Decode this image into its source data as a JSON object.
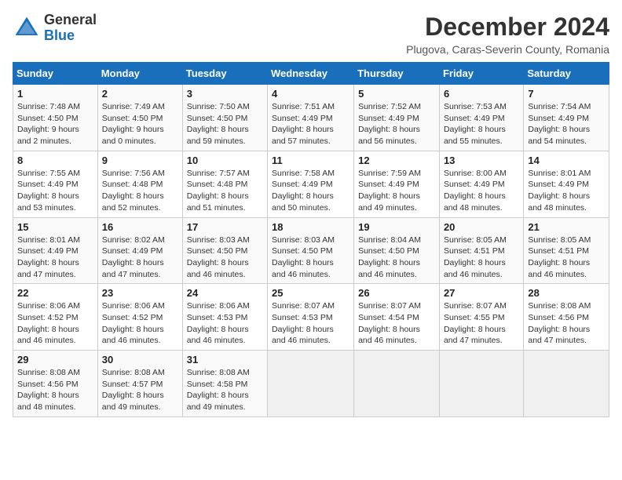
{
  "header": {
    "logo_general": "General",
    "logo_blue": "Blue",
    "month_title": "December 2024",
    "location": "Plugova, Caras-Severin County, Romania"
  },
  "weekdays": [
    "Sunday",
    "Monday",
    "Tuesday",
    "Wednesday",
    "Thursday",
    "Friday",
    "Saturday"
  ],
  "weeks": [
    [
      {
        "day": "1",
        "info": "Sunrise: 7:48 AM\nSunset: 4:50 PM\nDaylight: 9 hours\nand 2 minutes."
      },
      {
        "day": "2",
        "info": "Sunrise: 7:49 AM\nSunset: 4:50 PM\nDaylight: 9 hours\nand 0 minutes."
      },
      {
        "day": "3",
        "info": "Sunrise: 7:50 AM\nSunset: 4:50 PM\nDaylight: 8 hours\nand 59 minutes."
      },
      {
        "day": "4",
        "info": "Sunrise: 7:51 AM\nSunset: 4:49 PM\nDaylight: 8 hours\nand 57 minutes."
      },
      {
        "day": "5",
        "info": "Sunrise: 7:52 AM\nSunset: 4:49 PM\nDaylight: 8 hours\nand 56 minutes."
      },
      {
        "day": "6",
        "info": "Sunrise: 7:53 AM\nSunset: 4:49 PM\nDaylight: 8 hours\nand 55 minutes."
      },
      {
        "day": "7",
        "info": "Sunrise: 7:54 AM\nSunset: 4:49 PM\nDaylight: 8 hours\nand 54 minutes."
      }
    ],
    [
      {
        "day": "8",
        "info": "Sunrise: 7:55 AM\nSunset: 4:49 PM\nDaylight: 8 hours\nand 53 minutes."
      },
      {
        "day": "9",
        "info": "Sunrise: 7:56 AM\nSunset: 4:48 PM\nDaylight: 8 hours\nand 52 minutes."
      },
      {
        "day": "10",
        "info": "Sunrise: 7:57 AM\nSunset: 4:48 PM\nDaylight: 8 hours\nand 51 minutes."
      },
      {
        "day": "11",
        "info": "Sunrise: 7:58 AM\nSunset: 4:49 PM\nDaylight: 8 hours\nand 50 minutes."
      },
      {
        "day": "12",
        "info": "Sunrise: 7:59 AM\nSunset: 4:49 PM\nDaylight: 8 hours\nand 49 minutes."
      },
      {
        "day": "13",
        "info": "Sunrise: 8:00 AM\nSunset: 4:49 PM\nDaylight: 8 hours\nand 48 minutes."
      },
      {
        "day": "14",
        "info": "Sunrise: 8:01 AM\nSunset: 4:49 PM\nDaylight: 8 hours\nand 48 minutes."
      }
    ],
    [
      {
        "day": "15",
        "info": "Sunrise: 8:01 AM\nSunset: 4:49 PM\nDaylight: 8 hours\nand 47 minutes."
      },
      {
        "day": "16",
        "info": "Sunrise: 8:02 AM\nSunset: 4:49 PM\nDaylight: 8 hours\nand 47 minutes."
      },
      {
        "day": "17",
        "info": "Sunrise: 8:03 AM\nSunset: 4:50 PM\nDaylight: 8 hours\nand 46 minutes."
      },
      {
        "day": "18",
        "info": "Sunrise: 8:03 AM\nSunset: 4:50 PM\nDaylight: 8 hours\nand 46 minutes."
      },
      {
        "day": "19",
        "info": "Sunrise: 8:04 AM\nSunset: 4:50 PM\nDaylight: 8 hours\nand 46 minutes."
      },
      {
        "day": "20",
        "info": "Sunrise: 8:05 AM\nSunset: 4:51 PM\nDaylight: 8 hours\nand 46 minutes."
      },
      {
        "day": "21",
        "info": "Sunrise: 8:05 AM\nSunset: 4:51 PM\nDaylight: 8 hours\nand 46 minutes."
      }
    ],
    [
      {
        "day": "22",
        "info": "Sunrise: 8:06 AM\nSunset: 4:52 PM\nDaylight: 8 hours\nand 46 minutes."
      },
      {
        "day": "23",
        "info": "Sunrise: 8:06 AM\nSunset: 4:52 PM\nDaylight: 8 hours\nand 46 minutes."
      },
      {
        "day": "24",
        "info": "Sunrise: 8:06 AM\nSunset: 4:53 PM\nDaylight: 8 hours\nand 46 minutes."
      },
      {
        "day": "25",
        "info": "Sunrise: 8:07 AM\nSunset: 4:53 PM\nDaylight: 8 hours\nand 46 minutes."
      },
      {
        "day": "26",
        "info": "Sunrise: 8:07 AM\nSunset: 4:54 PM\nDaylight: 8 hours\nand 46 minutes."
      },
      {
        "day": "27",
        "info": "Sunrise: 8:07 AM\nSunset: 4:55 PM\nDaylight: 8 hours\nand 47 minutes."
      },
      {
        "day": "28",
        "info": "Sunrise: 8:08 AM\nSunset: 4:56 PM\nDaylight: 8 hours\nand 47 minutes."
      }
    ],
    [
      {
        "day": "29",
        "info": "Sunrise: 8:08 AM\nSunset: 4:56 PM\nDaylight: 8 hours\nand 48 minutes."
      },
      {
        "day": "30",
        "info": "Sunrise: 8:08 AM\nSunset: 4:57 PM\nDaylight: 8 hours\nand 49 minutes."
      },
      {
        "day": "31",
        "info": "Sunrise: 8:08 AM\nSunset: 4:58 PM\nDaylight: 8 hours\nand 49 minutes."
      },
      null,
      null,
      null,
      null
    ]
  ]
}
